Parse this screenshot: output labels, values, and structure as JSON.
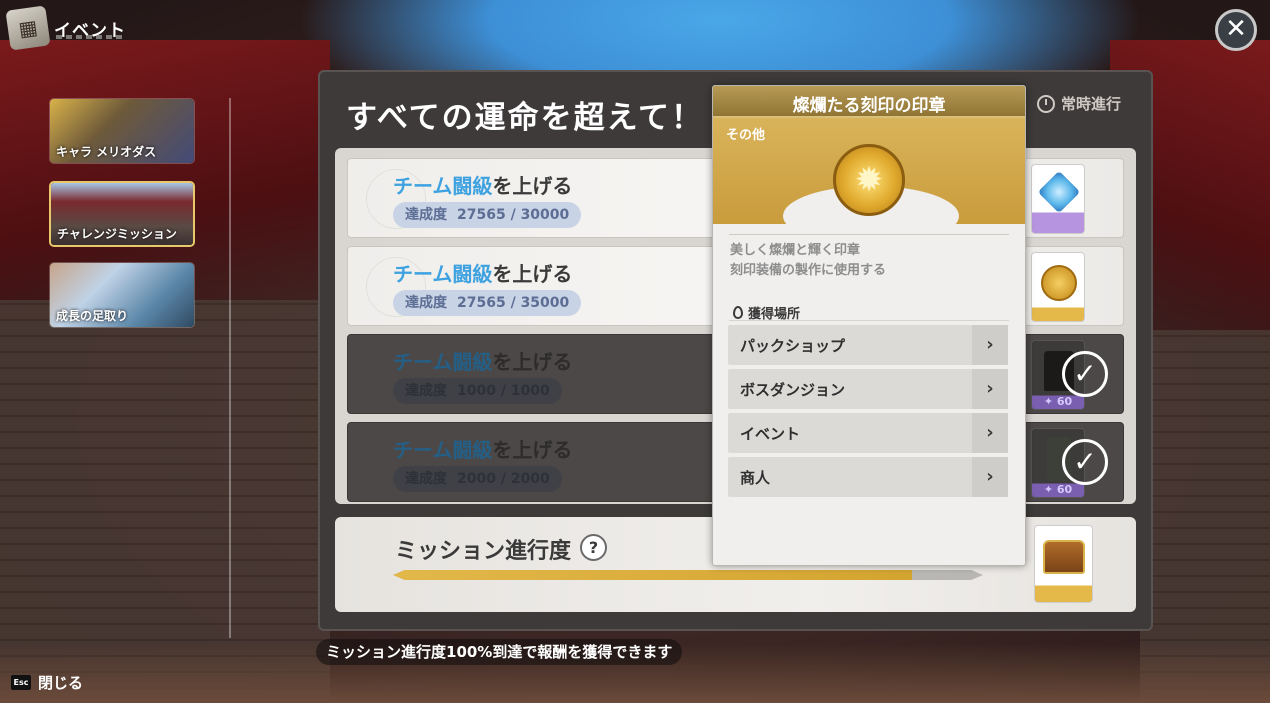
{
  "header": {
    "title": "イベント",
    "close_glyph": "✕"
  },
  "tabs": [
    {
      "label": "キャラ メリオダス"
    },
    {
      "label": "チャレンジミッション"
    },
    {
      "label": "成長の足取り"
    }
  ],
  "panel": {
    "title": "すべての運命を超えて！",
    "always_label": "常時進行"
  },
  "missions": [
    {
      "title_hl": "チーム闘級",
      "title_rest": "を上げる",
      "progress_label": "達成度",
      "progress_value": "27565 / 30000",
      "completed": false,
      "reward_icon": "gem-icon"
    },
    {
      "title_hl": "チーム闘級",
      "title_rest": "を上げる",
      "progress_label": "達成度",
      "progress_value": "27565 / 35000",
      "completed": false,
      "reward_icon": "seal-coin-icon"
    },
    {
      "title_hl": "チーム闘級",
      "title_rest": "を上げる",
      "progress_label": "達成度",
      "progress_value": "1000 / 1000",
      "completed": true,
      "reward_icon": "coat-icon",
      "reward_plus": "✦ 60"
    },
    {
      "title_hl": "チーム闘級",
      "title_rest": "を上げる",
      "progress_label": "達成度",
      "progress_value": "2000 / 2000",
      "completed": true,
      "reward_icon": "pants-icon",
      "reward_plus": "✦ 60"
    }
  ],
  "mission_progress": {
    "title": "ミッション進行度",
    "help_glyph": "?",
    "fill_percent": 88
  },
  "hint": "ミッション進行度100%到達で報酬を獲得できます",
  "footer": {
    "esc_key": "Esc",
    "close_label": "閉じる"
  },
  "tooltip": {
    "title": "燦爛たる刻印の印章",
    "category": "その他",
    "description": [
      "美しく燦爛と輝く印章",
      "刻印装備の製作に使用する"
    ],
    "obtain_label": "獲得場所",
    "sources": [
      "パックショップ",
      "ボスダンジョン",
      "イベント",
      "商人"
    ],
    "arrow_glyph": "›"
  },
  "colors": {
    "accent_blue": "#3ea1e0",
    "gold": "#d4a430",
    "tab_selected_border": "#e8c86a"
  }
}
